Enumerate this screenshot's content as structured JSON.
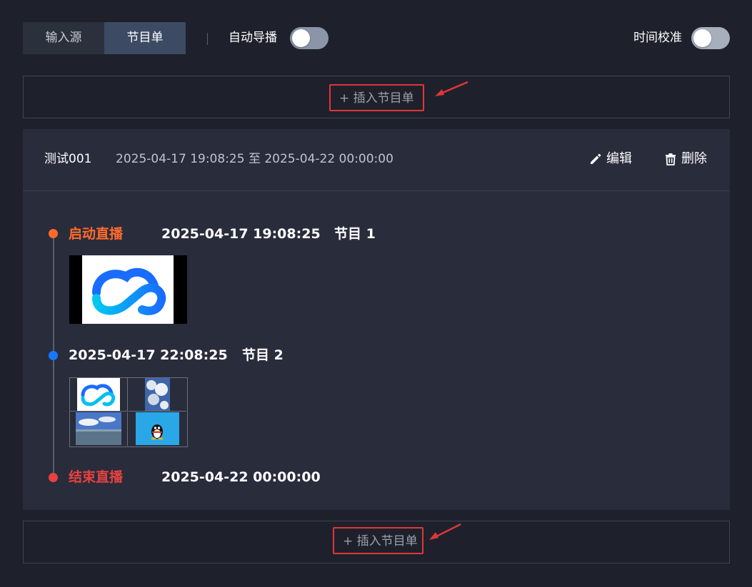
{
  "tabs": [
    {
      "label": "输入源",
      "active": false
    },
    {
      "label": "节目单",
      "active": true
    }
  ],
  "auto_director": {
    "label": "自动导播",
    "on": false
  },
  "time_calibration": {
    "label": "时间校准",
    "on": false
  },
  "insert_button_label": "+ 插入节目单",
  "playlist": {
    "name": "测试001",
    "range": "2025-04-17 19:08:25 至 2025-04-22 00:00:00",
    "edit_label": "编辑",
    "delete_label": "删除",
    "timeline": {
      "start": {
        "label": "启动直播",
        "time": "2025-04-17 19:08:25",
        "program": "节目 1"
      },
      "mid": {
        "time": "2025-04-17 22:08:25",
        "program": "节目 2"
      },
      "end": {
        "label": "结束直播",
        "time": "2025-04-22 00:00:00"
      }
    }
  },
  "icons": {
    "edit": "pencil-icon",
    "delete": "trash-icon",
    "logo": "tencent-cloud-logo",
    "qq": "qq-penguin-icon"
  },
  "colors": {
    "start": "#ff6a2b",
    "live_point": "#1777ff",
    "end": "#e8423f",
    "highlight": "#e0363a"
  }
}
